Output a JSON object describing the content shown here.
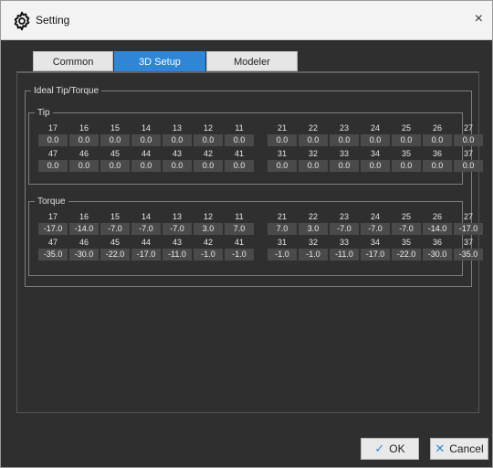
{
  "window": {
    "title": "Setting",
    "close_symbol": "×"
  },
  "tabs": [
    {
      "label": "Common",
      "active": false
    },
    {
      "label": "3D Setup",
      "active": true
    },
    {
      "label": "Modeler",
      "active": false
    }
  ],
  "ideal_group": {
    "label": "Ideal Tip/Torque"
  },
  "tip": {
    "label": "Tip",
    "upper_teeth": [
      "17",
      "16",
      "15",
      "14",
      "13",
      "12",
      "11",
      "21",
      "22",
      "23",
      "24",
      "25",
      "26",
      "27"
    ],
    "upper_values": [
      "0.0",
      "0.0",
      "0.0",
      "0.0",
      "0.0",
      "0.0",
      "0.0",
      "0.0",
      "0.0",
      "0.0",
      "0.0",
      "0.0",
      "0.0",
      "0.0"
    ],
    "lower_teeth": [
      "47",
      "46",
      "45",
      "44",
      "43",
      "42",
      "41",
      "31",
      "32",
      "33",
      "34",
      "35",
      "36",
      "37"
    ],
    "lower_values": [
      "0.0",
      "0.0",
      "0.0",
      "0.0",
      "0.0",
      "0.0",
      "0.0",
      "0.0",
      "0.0",
      "0.0",
      "0.0",
      "0.0",
      "0.0",
      "0.0"
    ]
  },
  "torque": {
    "label": "Torque",
    "upper_teeth": [
      "17",
      "16",
      "15",
      "14",
      "13",
      "12",
      "11",
      "21",
      "22",
      "23",
      "24",
      "25",
      "26",
      "27"
    ],
    "upper_values": [
      "-17.0",
      "-14.0",
      "-7.0",
      "-7.0",
      "-7.0",
      "3.0",
      "7.0",
      "7.0",
      "3.0",
      "-7.0",
      "-7.0",
      "-7.0",
      "-14.0",
      "-17.0"
    ],
    "lower_teeth": [
      "47",
      "46",
      "45",
      "44",
      "43",
      "42",
      "41",
      "31",
      "32",
      "33",
      "34",
      "35",
      "36",
      "37"
    ],
    "lower_values": [
      "-35.0",
      "-30.0",
      "-22.0",
      "-17.0",
      "-11.0",
      "-1.0",
      "-1.0",
      "-1.0",
      "-1.0",
      "-11.0",
      "-17.0",
      "-22.0",
      "-30.0",
      "-35.0"
    ]
  },
  "buttons": {
    "ok_label": "OK",
    "cancel_label": "Cancel"
  },
  "colors": {
    "accent": "#2f86d6",
    "background": "#2f2f2f",
    "value_cell": "#4a4a4a"
  },
  "icons": {
    "title": "gear-icon",
    "ok": "check-icon",
    "cancel": "x-icon"
  }
}
